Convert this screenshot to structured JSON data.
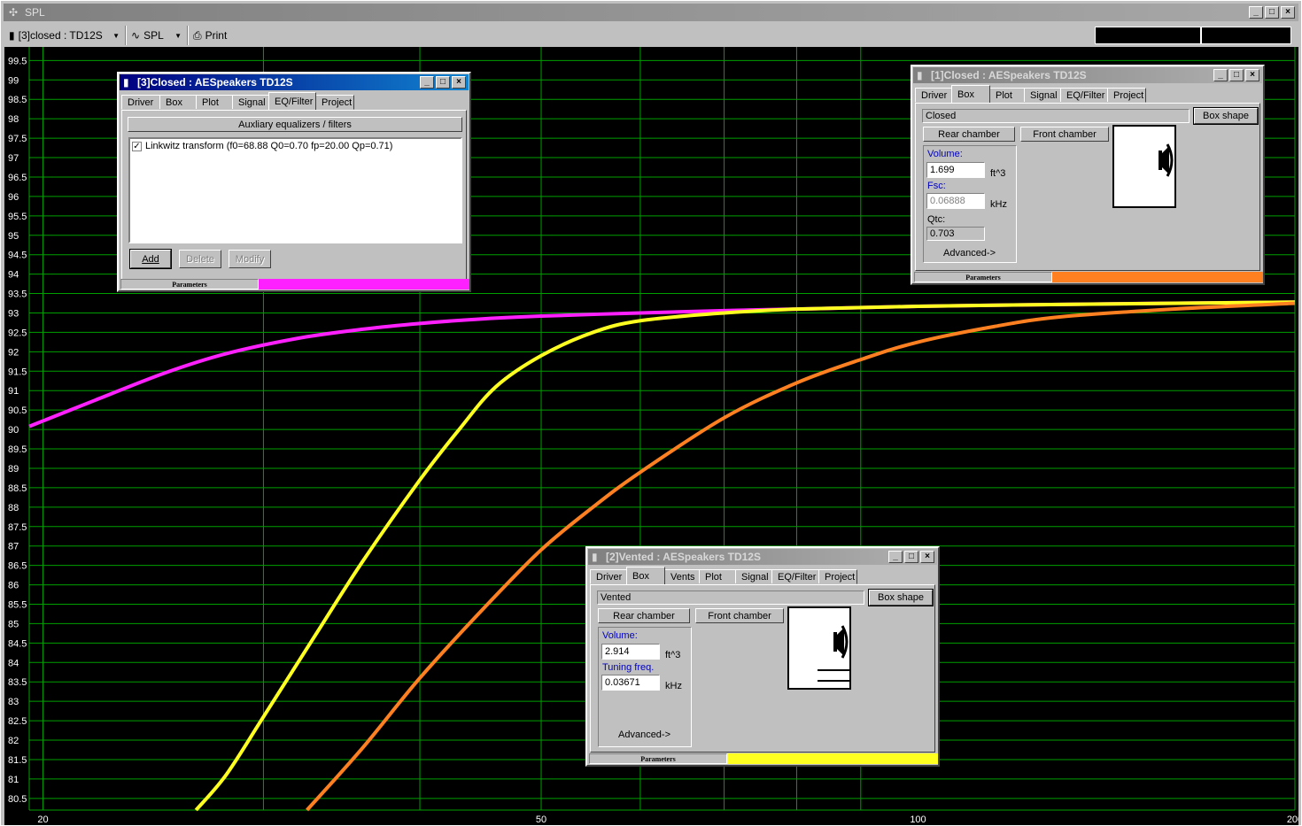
{
  "window": {
    "title": "SPL"
  },
  "toolbar": {
    "project_select": "[3]closed : TD12S",
    "plot_select": "SPL",
    "print_label": "Print"
  },
  "chart_data": {
    "type": "line",
    "xlabel": "",
    "ylabel": "",
    "xscale": "log",
    "xlim": [
      19.5,
      200
    ],
    "ylim": [
      80.2,
      99.85
    ],
    "x_ticks": [
      20,
      50,
      100,
      200
    ],
    "y_ticks": [
      80.5,
      81,
      81.5,
      82,
      82.5,
      83,
      83.5,
      84,
      84.5,
      85,
      85.5,
      86,
      86.5,
      87,
      87.5,
      88,
      88.5,
      89,
      89.5,
      90,
      90.5,
      91,
      91.5,
      92,
      92.5,
      93,
      93.5,
      94,
      94.5,
      95,
      95.5,
      96,
      96.5,
      97,
      97.5,
      98,
      98.5,
      99,
      99.5
    ],
    "grid": true,
    "series": [
      {
        "color": "#ff20ff",
        "x": [
          19.5,
          22,
          25,
          28,
          32,
          36,
          40,
          45,
          50,
          60,
          70,
          80,
          100,
          130,
          160,
          200
        ],
        "y": [
          90.08,
          90.75,
          91.45,
          91.95,
          92.35,
          92.58,
          92.73,
          92.85,
          92.92,
          93.0,
          93.06,
          93.1,
          93.17,
          93.22,
          93.25,
          93.28
        ]
      },
      {
        "color": "#ffff20",
        "x": [
          26.5,
          28,
          30,
          33,
          36,
          40,
          43,
          46,
          50,
          55,
          60,
          70,
          80,
          100,
          130,
          200
        ],
        "y": [
          80.2,
          81.1,
          82.6,
          84.7,
          86.6,
          88.7,
          90.0,
          91.1,
          91.9,
          92.5,
          92.8,
          93.0,
          93.1,
          93.17,
          93.22,
          93.28
        ]
      },
      {
        "color": "#ff8020",
        "x": [
          32.5,
          36,
          40,
          45,
          50,
          55,
          60,
          70,
          80,
          90,
          100,
          115,
          130,
          160,
          200
        ],
        "y": [
          80.2,
          81.8,
          83.6,
          85.4,
          86.9,
          88.0,
          88.9,
          90.3,
          91.2,
          91.8,
          92.25,
          92.65,
          92.9,
          93.1,
          93.25
        ]
      }
    ]
  },
  "dlg3": {
    "title": "[3]Closed : AESpeakers TD12S",
    "tabs": [
      "Driver",
      "Box",
      "Plot",
      "Signal",
      "EQ/Filter",
      "Project"
    ],
    "header": "Auxliary equalizers / filters",
    "filter_item": "Linkwitz transform (f0=68.88 Q0=0.70 fp=20.00 Qp=0.71)",
    "filter_checked": true,
    "buttons": {
      "add": "Add",
      "delete": "Delete",
      "modify": "Modify"
    },
    "status": "Parameters",
    "color": "#ff20ff"
  },
  "dlg1": {
    "title": "[1]Closed : AESpeakers TD12S",
    "tabs": [
      "Driver",
      "Box",
      "Plot",
      "Signal",
      "EQ/Filter",
      "Project"
    ],
    "box_type": "Closed",
    "box_shape_btn": "Box shape",
    "rear_btn": "Rear chamber",
    "front_btn": "Front chamber",
    "volume_label": "Volume:",
    "volume_value": "1.699",
    "volume_unit": "ft^3",
    "fsc_label": "Fsc:",
    "fsc_value": "0.06888",
    "fsc_unit": "kHz",
    "qtc_label": "Qtc:",
    "qtc_value": "0.703",
    "advanced": "Advanced->",
    "status": "Parameters",
    "color": "#ff8020"
  },
  "dlg2": {
    "title": "[2]Vented : AESpeakers TD12S",
    "tabs": [
      "Driver",
      "Box",
      "Vents",
      "Plot",
      "Signal",
      "EQ/Filter",
      "Project"
    ],
    "box_type": "Vented",
    "box_shape_btn": "Box shape",
    "rear_btn": "Rear chamber",
    "front_btn": "Front chamber",
    "volume_label": "Volume:",
    "volume_value": "2.914",
    "volume_unit": "ft^3",
    "tuning_label": "Tuning freq.",
    "tuning_value": "0.03671",
    "tuning_unit": "kHz",
    "advanced": "Advanced->",
    "status": "Parameters",
    "color": "#ffff20"
  }
}
